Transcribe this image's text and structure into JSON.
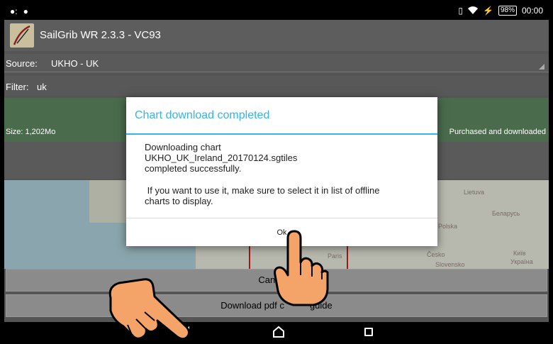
{
  "status_bar": {
    "time": "00:00",
    "battery": "98%"
  },
  "app": {
    "title": "SailGrib WR 2.3.3 - VC93"
  },
  "source": {
    "label": "Source:",
    "value": "UKHO - UK"
  },
  "filter": {
    "label": "Filter:",
    "value": "uk"
  },
  "chart_item": {
    "size": "Size: 1,202Mo",
    "status": "Purchased and downloaded"
  },
  "map_labels": {
    "lietuva": "Lietuva",
    "belarus": "Беларусь",
    "polska": "Polska",
    "paris": "Paris",
    "cesko": "Česko",
    "slovensko": "Slovensko",
    "kyiv": "Київ",
    "ukraina": "Україна"
  },
  "buttons": {
    "cancel": "Cancel L",
    "download_pdf": "Download pdf c          guide"
  },
  "dialog": {
    "title": "Chart download completed",
    "line1": "Downloading chart",
    "line2": "UKHO_UK_Ireland_20170124.sgtiles",
    "line3": "completed successfully.",
    "line4": " If you want to use it, make sure to select it in list of offline",
    "line5": "charts to display.",
    "ok": "Ok"
  },
  "colors": {
    "accent": "#33b5e5",
    "chart_row": "#4a6b4c"
  },
  "icons": [
    "vibrate-icon",
    "wifi-icon",
    "charging-icon",
    "back-icon",
    "home-icon",
    "recent-apps-icon",
    "hand-pointer-icon"
  ]
}
